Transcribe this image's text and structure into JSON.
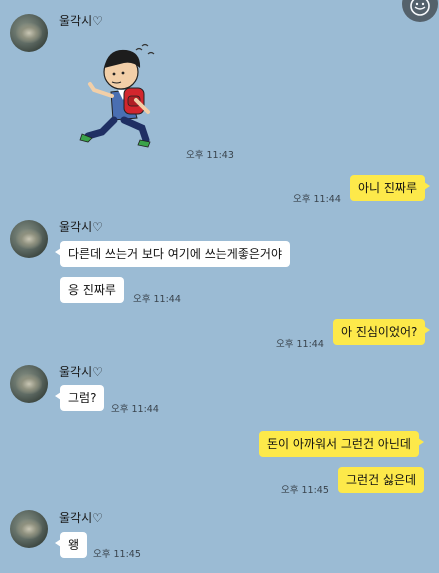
{
  "chat": {
    "sender_name": "울각시♡",
    "messages": [
      {
        "text": "아니 진짜루",
        "time": "오후 11:44"
      },
      {
        "text": "다른데 쓰는거 보다 여기에 쓰는게좋은거야"
      },
      {
        "text": "응 진짜루",
        "time": "오후 11:44"
      },
      {
        "text": "아 진심이었어?",
        "time": "오후 11:44"
      },
      {
        "text": "그럼?",
        "time": "오후 11:44"
      },
      {
        "text": "돈이 아까워서 그런건 아닌데"
      },
      {
        "text": "그런건 싫은데",
        "time": "오후 11:45"
      },
      {
        "text": "왱",
        "time": "오후 11:45"
      }
    ],
    "sticker": {
      "time": "오후 11:43",
      "icon": "running-student-sticker"
    }
  },
  "colors": {
    "background": "#9bbbd4",
    "outgoing_bubble": "#fde94a",
    "incoming_bubble": "#ffffff"
  }
}
